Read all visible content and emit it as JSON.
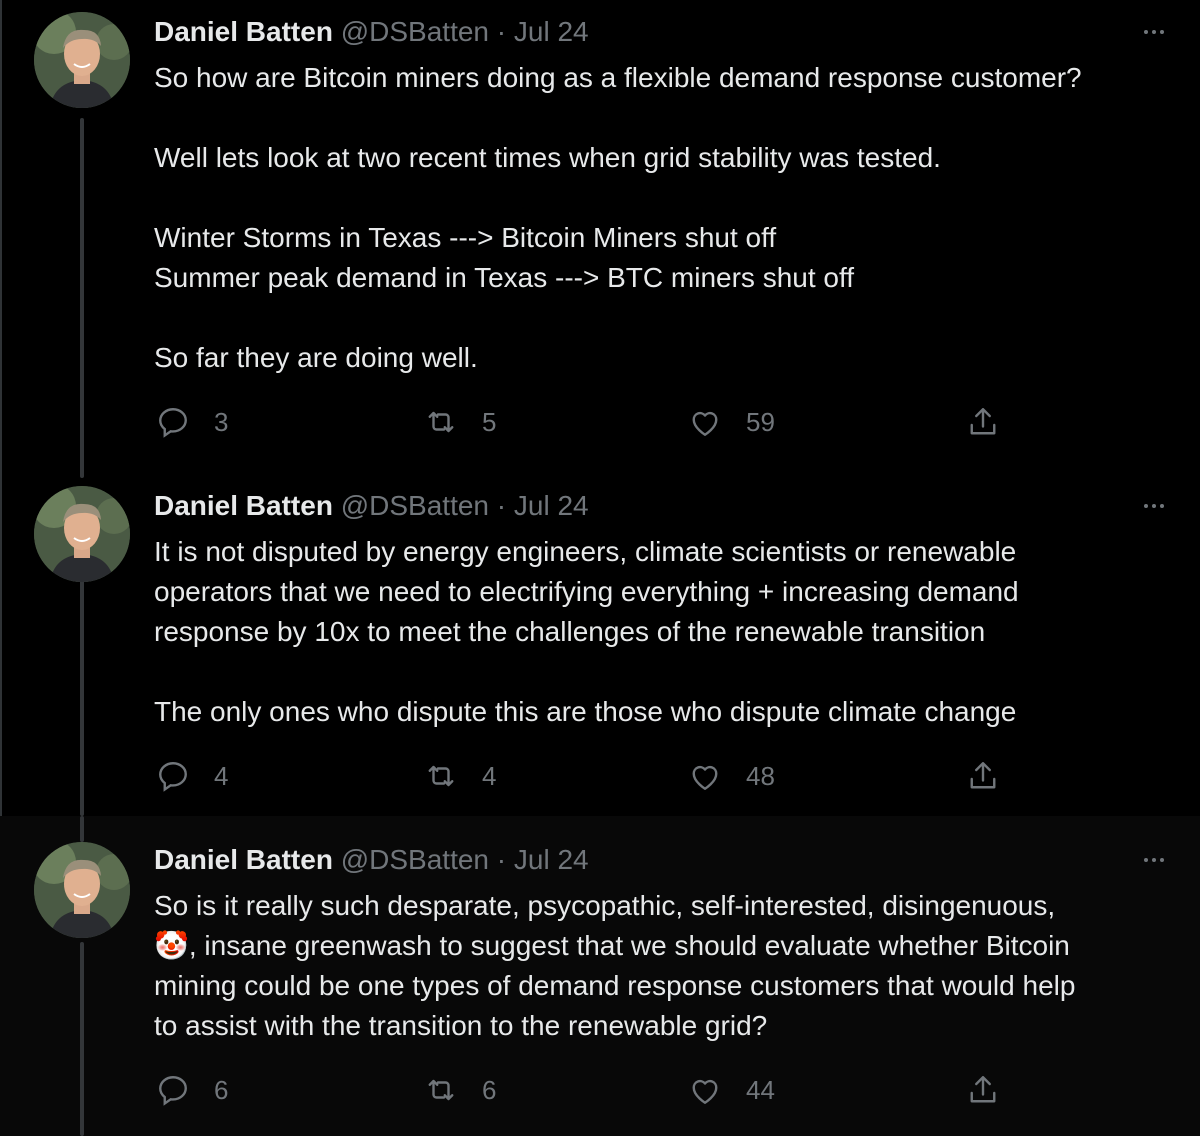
{
  "tweets": [
    {
      "name": "Daniel Batten",
      "handle": "@DSBatten",
      "separator": "·",
      "date": "Jul 24",
      "lines": [
        "So how are Bitcoin miners doing as a flexible demand response customer?",
        "",
        "Well lets look at two recent times when grid stability was tested.",
        "",
        "Winter Storms in Texas ---> Bitcoin Miners shut off",
        "Summer peak demand in Texas ---> BTC miners shut off",
        "",
        "So far they are doing well."
      ],
      "replies": "3",
      "retweets": "5",
      "likes": "59"
    },
    {
      "name": "Daniel Batten",
      "handle": "@DSBatten",
      "separator": "·",
      "date": "Jul 24",
      "lines": [
        "It is not disputed by energy engineers, climate scientists or renewable",
        "operators that we need to electrifying everything + increasing demand",
        "response by 10x to meet the challenges of the renewable transition",
        "",
        "The only ones who dispute this are those who dispute climate change"
      ],
      "replies": "4",
      "retweets": "4",
      "likes": "48"
    },
    {
      "name": "Daniel Batten",
      "handle": "@DSBatten",
      "separator": "·",
      "date": "Jul 24",
      "lines": [
        "So is it really such desparate, psycopathic, self-interested, disingenuous,",
        "🤡, insane greenwash to suggest that we should evaluate whether Bitcoin",
        "mining could be one types of demand response customers that would help",
        "to assist with the transition to the renewable grid?"
      ],
      "replies": "6",
      "retweets": "6",
      "likes": "44"
    }
  ],
  "colors": {
    "background": "#000000",
    "text": "#e7e9ea",
    "muted": "#71767b",
    "thread_line": "#333639",
    "highlight_background": "#080808"
  },
  "icons": [
    "reply-icon",
    "retweet-icon",
    "like-icon",
    "share-icon",
    "more-options-icon",
    "avatar"
  ]
}
